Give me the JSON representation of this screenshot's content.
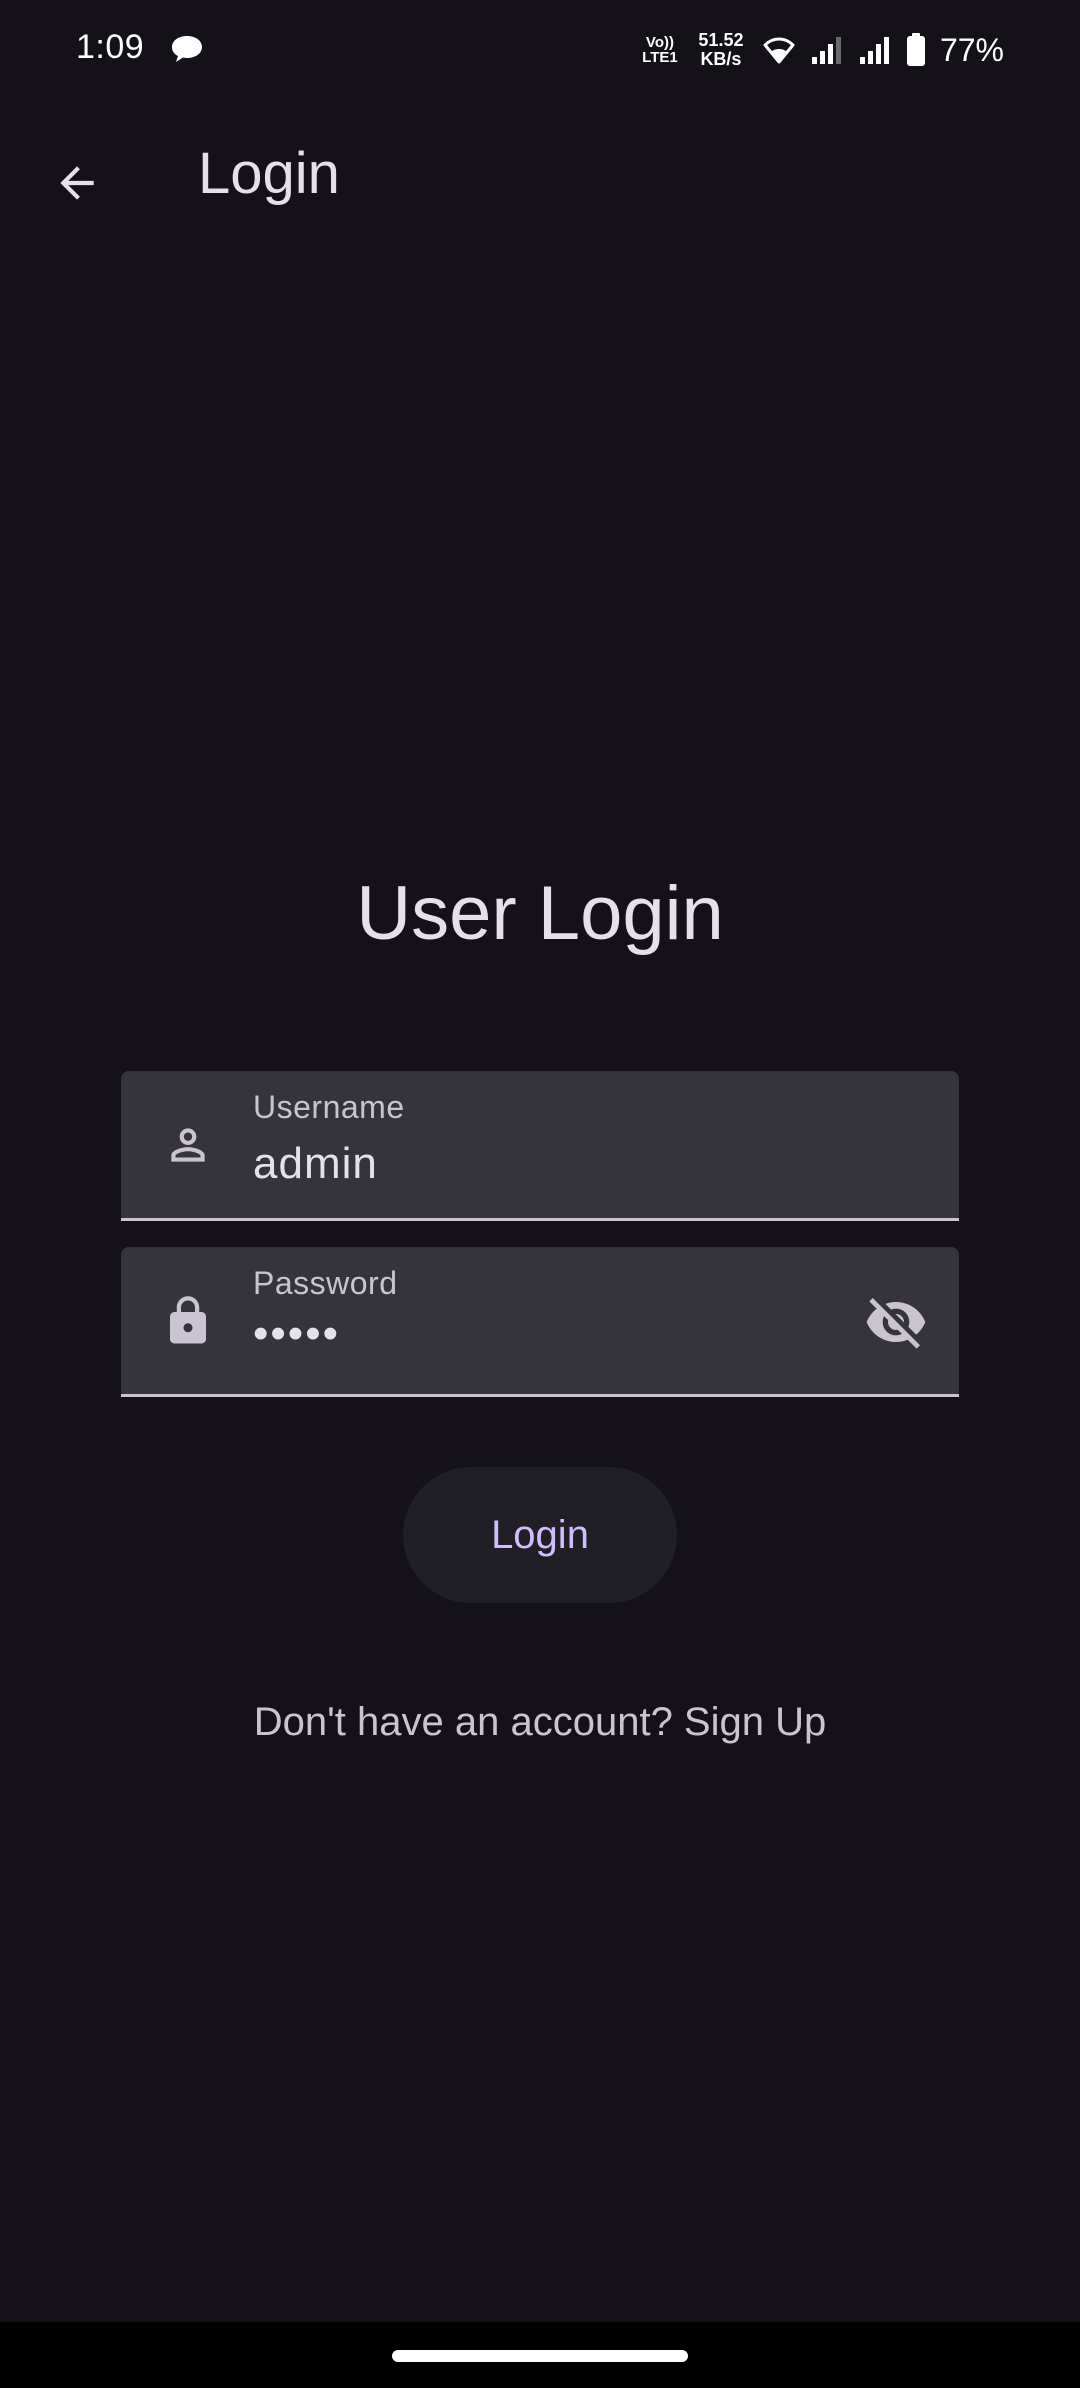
{
  "status_bar": {
    "time": "1:09",
    "volte_line1": "Vo))",
    "volte_line2": "LTE1",
    "speed_value": "51.52",
    "speed_unit": "KB/s",
    "battery_percent": "77%"
  },
  "app_bar": {
    "title": "Login"
  },
  "main": {
    "heading": "User Login",
    "username": {
      "label": "Username",
      "value": "admin"
    },
    "password": {
      "label": "Password",
      "value": "•••••"
    },
    "login_button_label": "Login",
    "signup_text": "Don't have an account? Sign Up"
  },
  "colors": {
    "background": "#141218",
    "field_fill": "#36343b",
    "accent": "#d0bcff",
    "on_surface": "#e6e0e9",
    "on_surface_variant": "#cac4d0"
  },
  "icons": {
    "back": "arrow-back-icon",
    "username": "person-icon",
    "password": "lock-icon",
    "visibility": "visibility-off-icon"
  }
}
